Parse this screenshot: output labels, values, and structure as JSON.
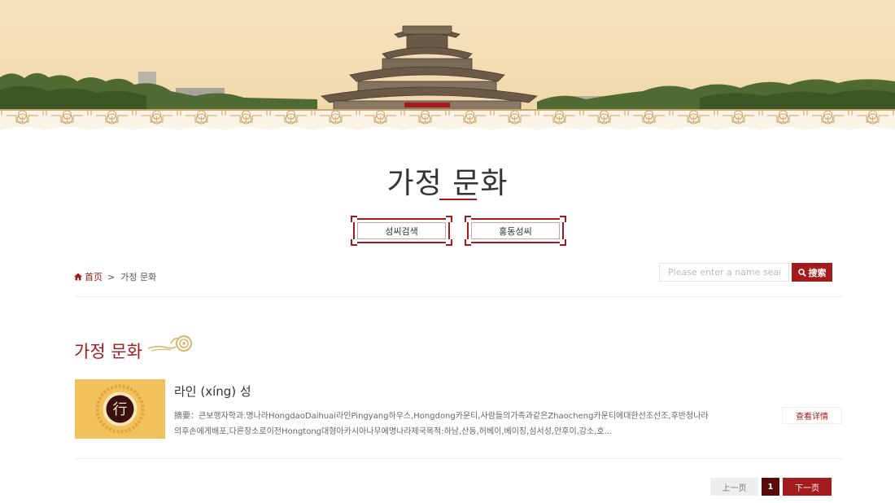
{
  "banner": {
    "image": "temple-landscape-banner"
  },
  "page_title": "가정 문화",
  "nav_buttons": [
    {
      "label": "성씨검색"
    },
    {
      "label": "홍동성씨"
    }
  ],
  "breadcrumb": {
    "home": "首页",
    "separator": ">",
    "current": "가정 문화"
  },
  "search": {
    "placeholder": "Please enter a name search",
    "button_label": "搜索"
  },
  "section_title": "가정 문화",
  "article": {
    "thumbnail_char": "行",
    "title": "라인 (xíng) 성",
    "summary": "摘要：큰보행자학과.명나라HongdaoDaihuai라인Pingyang하우스,Hongdong카운티,사람들의가족과같은Zhaocheng카운티에대한선조선조,후반청나라의후손에게배포,다른장소로이전Hongtong대형아카시아나무에명나라제국목적:하남,산동,허베이,베이징,섬서성,안후이,강소,호...",
    "detail_label": "查看详情"
  },
  "pagination": {
    "prev": "上一页",
    "current": "1",
    "next": "下一页"
  },
  "colors": {
    "accent": "#a31b1b",
    "banner_bg": "#f3dcb2"
  }
}
